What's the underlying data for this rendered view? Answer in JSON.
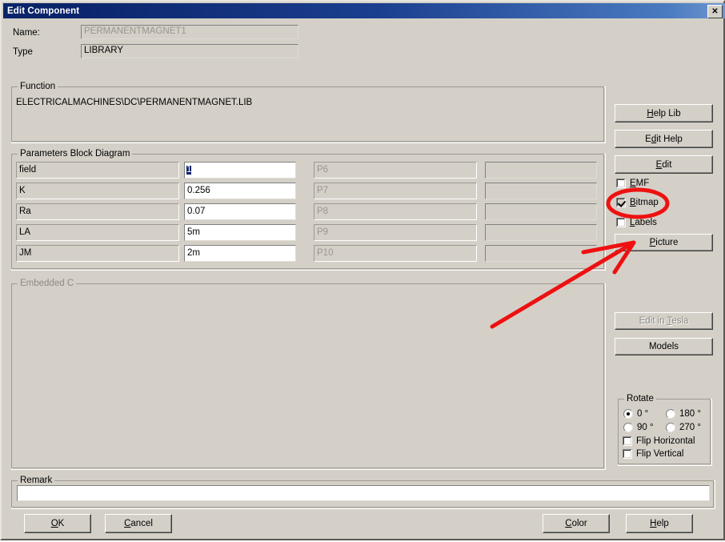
{
  "window": {
    "title": "Edit Component",
    "close_label": "✕"
  },
  "header": {
    "name_label": "Name:",
    "name_value": "PERMANENTMAGNET1",
    "type_label": "Type",
    "type_value": "LIBRARY"
  },
  "function_group": {
    "title": "Function",
    "path": "ELECTRICALMACHINES\\DC\\PERMANENTMAGNET.LIB"
  },
  "parameters_group": {
    "title": "Parameters Block Diagram",
    "left_rows": [
      {
        "name": "field",
        "value": "1",
        "selected": true
      },
      {
        "name": "K",
        "value": "0.256",
        "selected": false
      },
      {
        "name": "Ra",
        "value": "0.07",
        "selected": false
      },
      {
        "name": "LA",
        "value": "5m",
        "selected": false
      },
      {
        "name": "JM",
        "value": "2m",
        "selected": false
      }
    ],
    "right_rows": [
      {
        "name": "P6",
        "value": ""
      },
      {
        "name": "P7",
        "value": ""
      },
      {
        "name": "P8",
        "value": ""
      },
      {
        "name": "P9",
        "value": ""
      },
      {
        "name": "P10",
        "value": ""
      }
    ]
  },
  "embedded_c_group": {
    "title": "Embedded C",
    "content": ""
  },
  "remark_group": {
    "title": "Remark",
    "value": ""
  },
  "side_panel": {
    "help_lib_label": "Help Lib",
    "help_lib_mnemonic": "H",
    "edit_help_label": "Edit Help",
    "edit_help_mnemonic": "d",
    "edit_label": "Edit",
    "edit_mnemonic": "E",
    "emf_label": "EMF",
    "emf_mnemonic": "E",
    "emf_checked": false,
    "bitmap_label": "Bitmap",
    "bitmap_mnemonic": "B",
    "bitmap_checked": true,
    "labels_label": "Labels",
    "labels_mnemonic": "L",
    "labels_checked": false,
    "picture_label": "Picture",
    "picture_mnemonic": "P",
    "edit_in_tesla_label": "Edit in Tesla",
    "edit_in_tesla_mnemonic": "T",
    "edit_in_tesla_disabled": true,
    "models_label": "Models"
  },
  "rotate_group": {
    "title": "Rotate",
    "options": [
      {
        "label": "0 °",
        "selected": true
      },
      {
        "label": "180 °",
        "selected": false
      },
      {
        "label": "90 °",
        "selected": false
      },
      {
        "label": "270 °",
        "selected": false
      }
    ],
    "flip_horizontal_label": "Flip Horizontal",
    "flip_horizontal_checked": false,
    "flip_vertical_label": "Flip Vertical",
    "flip_vertical_checked": false
  },
  "footer": {
    "ok_label": "OK",
    "ok_mnemonic": "O",
    "cancel_label": "Cancel",
    "cancel_mnemonic": "C",
    "color_label": "Color",
    "color_mnemonic": "C",
    "help_label": "Help",
    "help_mnemonic": "H"
  },
  "annotation": {
    "color": "#ee1111",
    "ellipse_target": "bitmap-checkbox",
    "arrow_target": "picture-button"
  }
}
